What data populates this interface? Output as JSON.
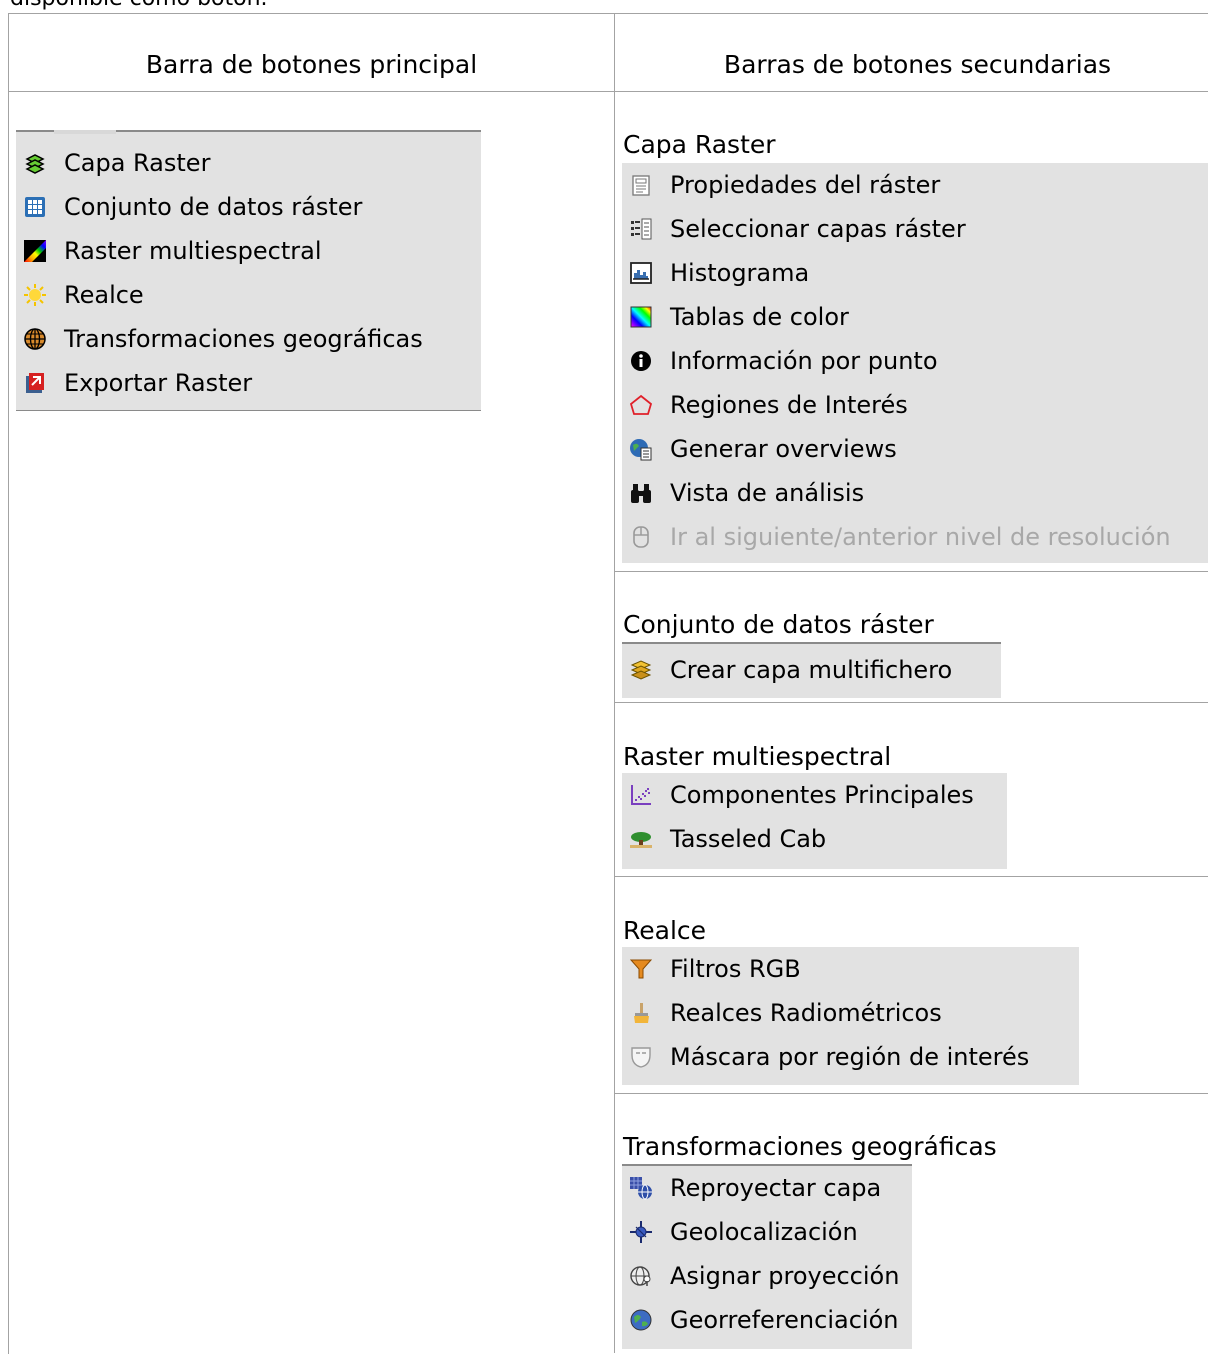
{
  "intro_text": "disponible como botón.",
  "headers": {
    "main": "Barra de botones principal",
    "secondary": "Barras de botones secundarias"
  },
  "main_bar": [
    {
      "label": "Capa Raster",
      "icon": "layers-stack-icon"
    },
    {
      "label": "Conjunto de datos ráster",
      "icon": "grid-table-icon"
    },
    {
      "label": "Raster multiespectral",
      "icon": "spectrum-icon"
    },
    {
      "label": "Realce",
      "icon": "sun-icon"
    },
    {
      "label": "Transformaciones geográficas",
      "icon": "globe-icon"
    },
    {
      "label": "Exportar Raster",
      "icon": "export-icon"
    }
  ],
  "sections": [
    {
      "title": "Capa Raster",
      "items": [
        {
          "label": "Propiedades del ráster",
          "icon": "properties-icon"
        },
        {
          "label": "Seleccionar capas ráster",
          "icon": "select-layers-icon"
        },
        {
          "label": "Histograma",
          "icon": "histogram-icon"
        },
        {
          "label": "Tablas de color",
          "icon": "color-table-icon"
        },
        {
          "label": "Información por punto",
          "icon": "info-icon"
        },
        {
          "label": "Regiones de Interés",
          "icon": "region-polygon-icon"
        },
        {
          "label": "Generar overviews",
          "icon": "overviews-icon"
        },
        {
          "label": "Vista de análisis",
          "icon": "binoculars-icon"
        },
        {
          "label": "Ir al siguiente/anterior nivel de resolución",
          "icon": "mouse-icon",
          "disabled": true
        }
      ]
    },
    {
      "title": "Conjunto de datos ráster",
      "items": [
        {
          "label": "Crear capa multifichero",
          "icon": "multifile-layers-icon"
        }
      ]
    },
    {
      "title": "Raster multiespectral",
      "items": [
        {
          "label": "Componentes Principales",
          "icon": "scatter-plot-icon"
        },
        {
          "label": "Tasseled Cab",
          "icon": "tree-icon"
        }
      ]
    },
    {
      "title": "Realce",
      "items": [
        {
          "label": "Filtros RGB",
          "icon": "filter-funnel-icon"
        },
        {
          "label": "Realces Radiométricos",
          "icon": "brush-icon"
        },
        {
          "label": "Máscara por región de interés",
          "icon": "mask-icon"
        }
      ]
    },
    {
      "title": "Transformaciones geográficas",
      "items": [
        {
          "label": "Reproyectar capa",
          "icon": "reproject-icon"
        },
        {
          "label": "Geolocalización",
          "icon": "geolocation-icon"
        },
        {
          "label": "Asignar proyección",
          "icon": "assign-projection-icon"
        },
        {
          "label": "Georreferenciación",
          "icon": "georeference-icon"
        }
      ]
    }
  ]
}
